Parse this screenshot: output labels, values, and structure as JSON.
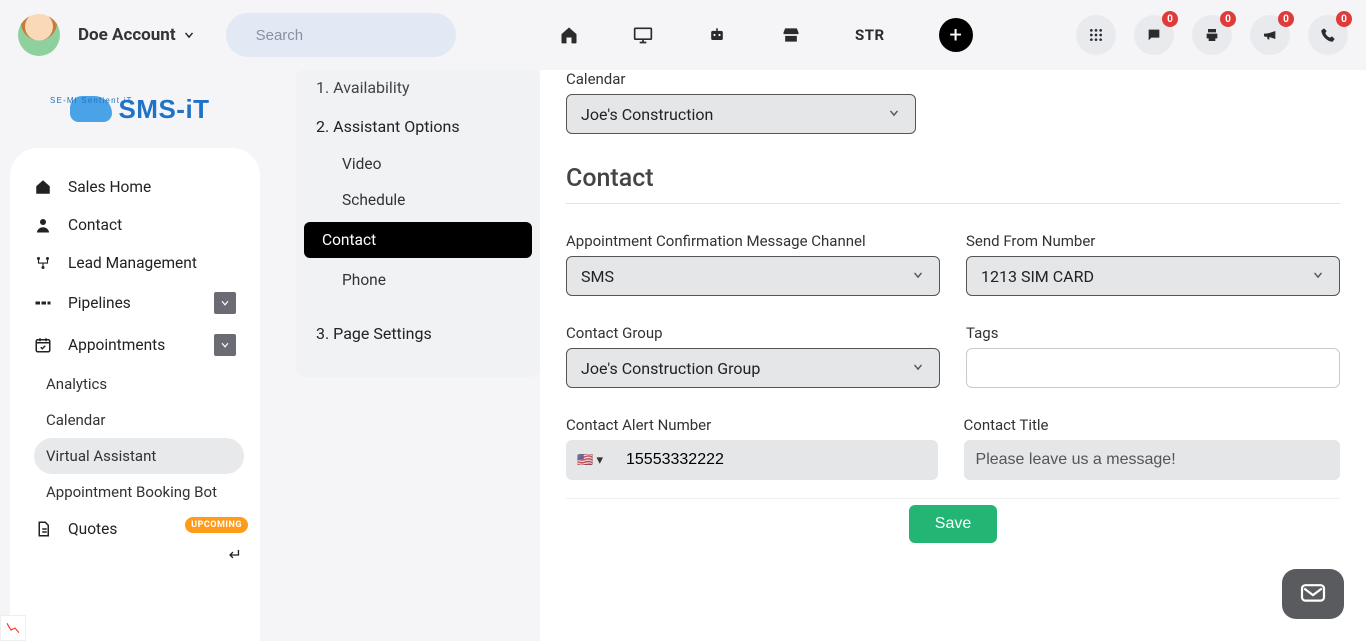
{
  "header": {
    "account_name": "Doe Account",
    "search_placeholder": "Search",
    "str_label": "STR",
    "badges": {
      "chat": "0",
      "print": "0",
      "announce": "0",
      "phone": "0"
    }
  },
  "logo": {
    "text": "SMS-iT",
    "tagline": "SE-Mi Sentient iT"
  },
  "sidebar": {
    "items": [
      {
        "icon": "home",
        "label": "Sales Home"
      },
      {
        "icon": "user",
        "label": "Contact"
      },
      {
        "icon": "graph",
        "label": "Lead Management"
      },
      {
        "icon": "pipe",
        "label": "Pipelines",
        "expandable": true
      },
      {
        "icon": "cal",
        "label": "Appointments",
        "expandable": true,
        "children": [
          {
            "label": "Analytics"
          },
          {
            "label": "Calendar"
          },
          {
            "label": "Virtual Assistant",
            "active": true
          },
          {
            "label": "Appointment Booking Bot"
          }
        ]
      },
      {
        "icon": "doc",
        "label": "Quotes",
        "badge": "UPCOMING"
      }
    ]
  },
  "steps": {
    "items": [
      {
        "label": "1. Availability",
        "truncated": true
      },
      {
        "label": "2. Assistant Options",
        "children": [
          {
            "label": "Video"
          },
          {
            "label": "Schedule"
          },
          {
            "label": "Contact",
            "active": true
          },
          {
            "label": "Phone"
          }
        ]
      },
      {
        "label": "3. Page Settings"
      }
    ]
  },
  "form": {
    "calendar_label": "Calendar",
    "calendar_value": "Joe's Construction",
    "section_title": "Contact",
    "channel_label": "Appointment Confirmation Message Channel",
    "channel_value": "SMS",
    "from_label": "Send From Number",
    "from_value": "1213 SIM CARD",
    "group_label": "Contact Group",
    "group_value": "Joe's Construction Group",
    "tags_label": "Tags",
    "tags_value": "",
    "alert_label": "Contact Alert Number",
    "alert_value": "15553332222",
    "title_label": "Contact Title",
    "title_value": "Please leave us a message!",
    "save_label": "Save"
  }
}
